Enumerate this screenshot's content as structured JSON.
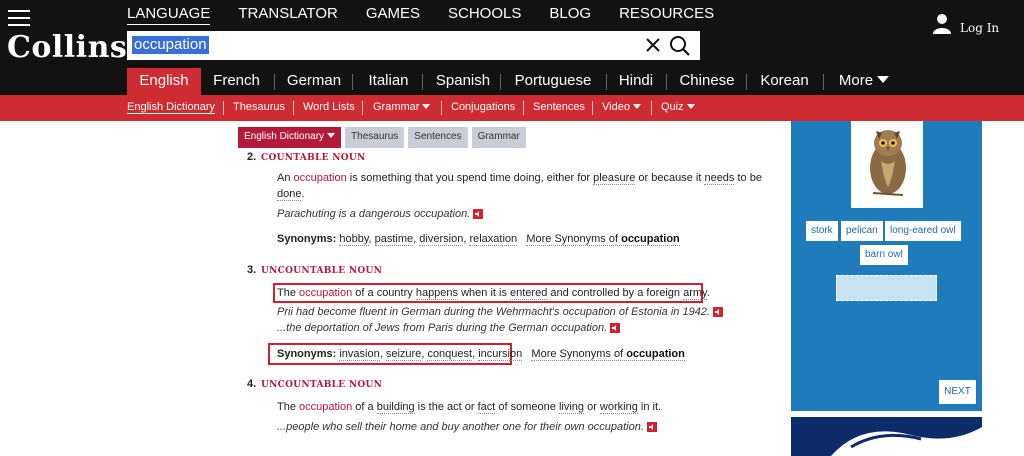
{
  "header": {
    "logo": "Collins",
    "nav": [
      "LANGUAGE",
      "TRANSLATOR",
      "GAMES",
      "SCHOOLS",
      "BLOG",
      "RESOURCES"
    ],
    "search_value": "occupation",
    "login_label": "Log In"
  },
  "languages": [
    "English",
    "French",
    "German",
    "Italian",
    "Spanish",
    "Portuguese",
    "Hindi",
    "Chinese",
    "Korean",
    "More"
  ],
  "subnav": [
    "English Dictionary",
    "Thesaurus",
    "Word Lists",
    "Grammar",
    "Conjugations",
    "Sentences",
    "Video",
    "Quiz"
  ],
  "tabs": [
    "English Dictionary",
    "Thesaurus",
    "Sentences",
    "Grammar"
  ],
  "entries": {
    "e2": {
      "num": "2.",
      "type": "COUNTABLE NOUN",
      "def_pre": "An ",
      "def_hw": "occupation",
      "def_mid": " is something that you spend time doing, either for ",
      "def_w1": "pleasure",
      "def_mid2": " or because it ",
      "def_w2": "needs",
      "def_mid3": " to be",
      "def_w3": "done",
      "def_end": ".",
      "example": "Parachuting is a dangerous occupation.",
      "syn_label": "Synonyms:",
      "synonyms": [
        "hobby",
        "pastime",
        "diversion",
        "relaxation"
      ],
      "more_syn": "More Synonyms of ",
      "more_syn_word": "occupation"
    },
    "e3": {
      "num": "3.",
      "type": "UNCOUNTABLE NOUN",
      "def_pre": "The ",
      "def_hw": "occupation",
      "def_a": " of a country ",
      "def_w1": "happens",
      "def_b": " when it is ",
      "def_w2": "entered",
      "def_c": " and controlled by a foreign ",
      "def_w3": "army",
      "def_end": ".",
      "example1": "Prii had become fluent in German during the Wehrmacht's occupation of Estonia in 1942.",
      "example2": "...the deportation of Jews from Paris during the German occupation.",
      "syn_label": "Synonyms:",
      "synonyms": [
        "invasion",
        "seizure",
        "conquest",
        "incursion"
      ],
      "more_syn": "More Synonyms of ",
      "more_syn_word": "occupation"
    },
    "e4": {
      "num": "4.",
      "type": "UNCOUNTABLE NOUN",
      "def_pre": "The ",
      "def_hw": "occupation",
      "def_a": " of a ",
      "def_w1": "building",
      "def_b": " is the act or ",
      "def_w2": "fact",
      "def_c": " of someone ",
      "def_w3": "living",
      "def_d": " or ",
      "def_w4": "working",
      "def_end": " in it.",
      "example": "...people who sell their home and buy another one for their own occupation."
    }
  },
  "sidebar": {
    "chips": [
      "stork",
      "pelican",
      "long-eared owl",
      "barn owl"
    ],
    "next_label": "NEXT"
  },
  "colors": {
    "brand_red": "#cf2b32",
    "headword_red": "#b5193a",
    "sidebar_blue": "#1f7bbb",
    "highlight_box": "#d3202e"
  }
}
